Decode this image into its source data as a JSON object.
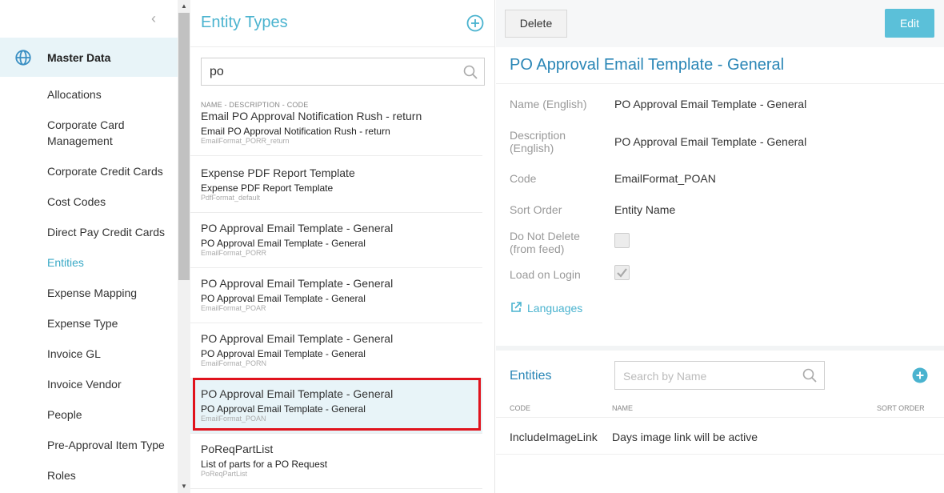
{
  "sidebar": {
    "section_title": "Master Data",
    "items": [
      {
        "label": "Allocations"
      },
      {
        "label": "Corporate Card Management"
      },
      {
        "label": "Corporate Credit Cards"
      },
      {
        "label": "Cost Codes"
      },
      {
        "label": "Direct Pay Credit Cards"
      },
      {
        "label": "Entities"
      },
      {
        "label": "Expense Mapping"
      },
      {
        "label": "Expense Type"
      },
      {
        "label": "Invoice GL"
      },
      {
        "label": "Invoice Vendor"
      },
      {
        "label": "People"
      },
      {
        "label": "Pre-Approval Item Type"
      },
      {
        "label": "Roles"
      }
    ],
    "active_item": "Entities"
  },
  "list": {
    "title": "Entity Types",
    "search_value": "po",
    "column_header": "NAME - DESCRIPTION - CODE",
    "items": [
      {
        "name": "Email PO Approval Notification Rush - return",
        "description": "Email PO Approval Notification Rush - return",
        "code": "EmailFormat_PORR_return"
      },
      {
        "name": "Expense PDF Report Template",
        "description": "Expense PDF Report Template",
        "code": "PdfFormat_default"
      },
      {
        "name": "PO Approval Email Template - General",
        "description": "PO Approval Email Template - General",
        "code": "EmailFormat_PORR"
      },
      {
        "name": "PO Approval Email Template - General",
        "description": "PO Approval Email Template - General",
        "code": "EmailFormat_POAR"
      },
      {
        "name": "PO Approval Email Template - General",
        "description": "PO Approval Email Template - General",
        "code": "EmailFormat_PORN"
      },
      {
        "name": "PO Approval Email Template - General",
        "description": "PO Approval Email Template - General",
        "code": "EmailFormat_POAN"
      },
      {
        "name": "PoReqPartList",
        "description": "List of parts for a PO Request",
        "code": "PoReqPartList"
      }
    ],
    "selected_index": 5
  },
  "detail": {
    "delete_label": "Delete",
    "edit_label": "Edit",
    "title": "PO Approval Email Template - General",
    "fields": {
      "name_label": "Name (English)",
      "name_value": "PO Approval Email Template - General",
      "desc_label_1": "Description",
      "desc_label_2": "(English)",
      "desc_value": "PO Approval Email Template - General",
      "code_label": "Code",
      "code_value": "EmailFormat_POAN",
      "sort_label": "Sort Order",
      "sort_value": "Entity Name",
      "dnd_label_1": "Do Not Delete",
      "dnd_label_2": "(from feed)",
      "dnd_checked": false,
      "login_label": "Load on Login",
      "login_checked": true
    },
    "languages_link": "Languages",
    "entities": {
      "title": "Entities",
      "search_placeholder": "Search by Name",
      "columns": {
        "code": "CODE",
        "name": "NAME",
        "sort": "SORT ORDER"
      },
      "rows": [
        {
          "code": "IncludeImageLink",
          "name": "Days image link will be active",
          "sort": ""
        }
      ]
    }
  },
  "colors": {
    "accent": "#4ab3cf",
    "title_blue": "#2a86b6",
    "selection_bg": "#e8f4f8",
    "highlight_border": "#e0131d",
    "edit_button": "#5bc0d9"
  }
}
